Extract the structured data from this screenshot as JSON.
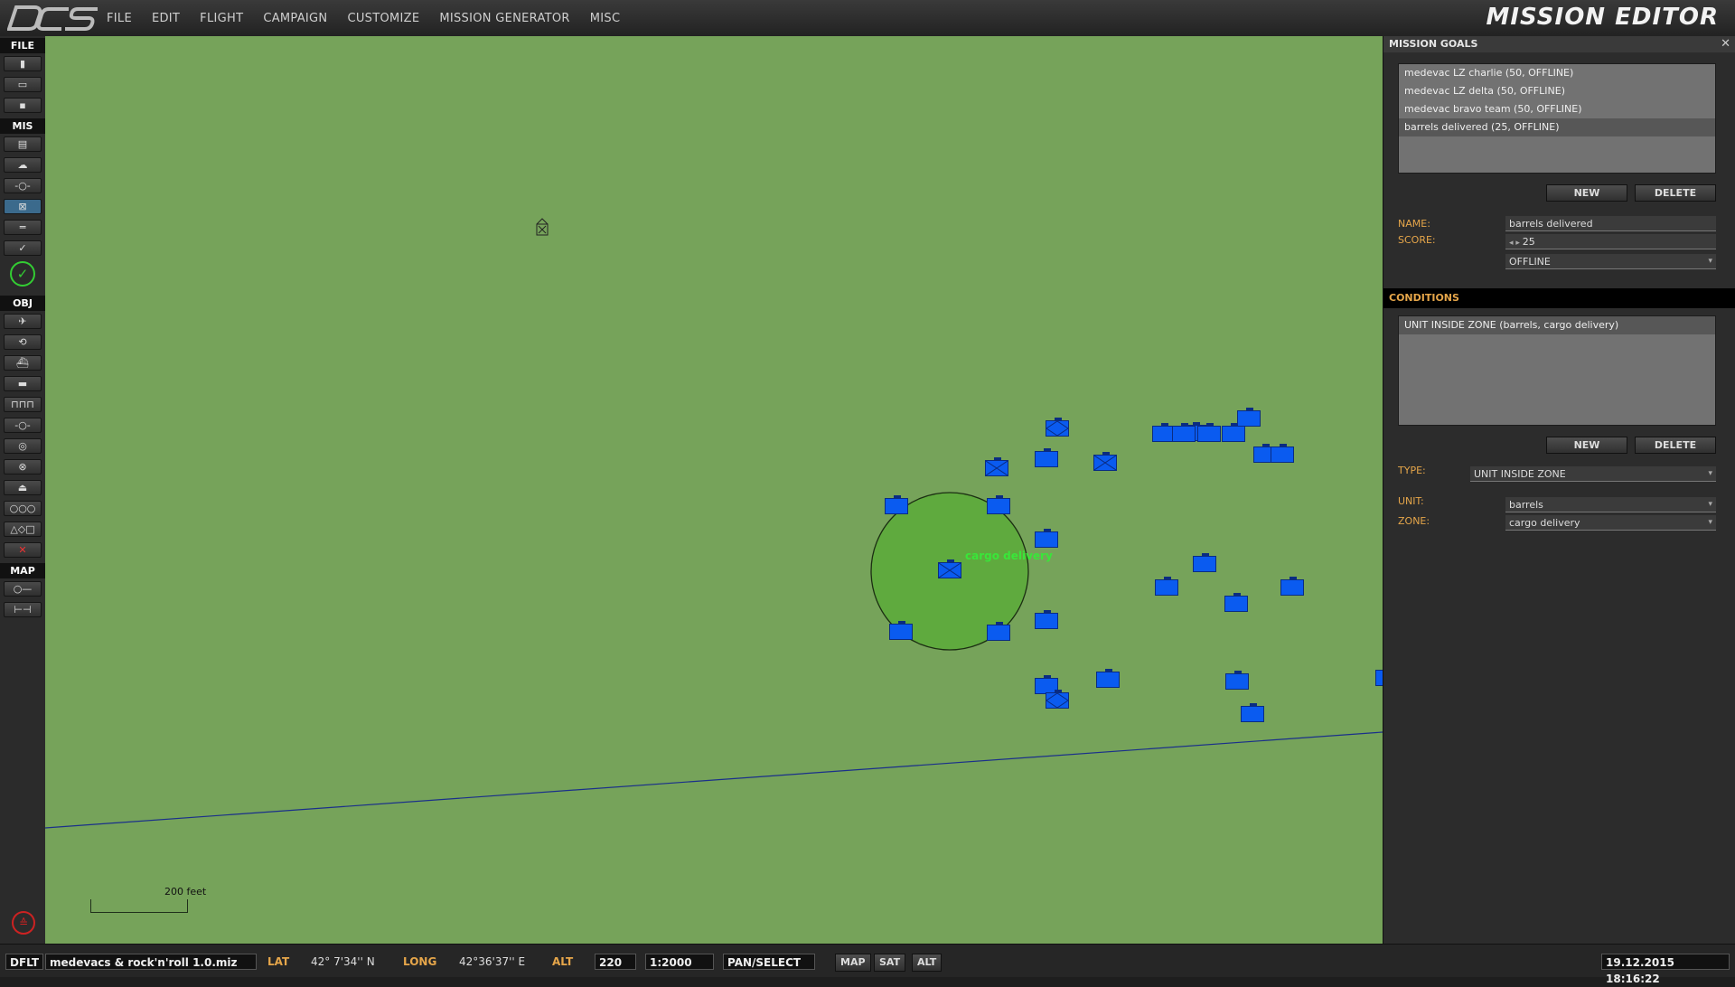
{
  "app": {
    "title": "MISSION EDITOR",
    "logo_text": "DCS"
  },
  "menu": [
    "FILE",
    "EDIT",
    "FLIGHT",
    "CAMPAIGN",
    "CUSTOMIZE",
    "MISSION GENERATOR",
    "MISC"
  ],
  "toolbar": {
    "sections": {
      "file": "FILE",
      "mis": "MIS",
      "obj": "OBJ",
      "map": "MAP"
    }
  },
  "map": {
    "zone_label": "cargo delivery",
    "scale_label": "200 feet"
  },
  "goals_panel": {
    "title": "MISSION GOALS",
    "goals": [
      "medevac LZ charlie (50, OFFLINE)",
      "medevac LZ delta (50, OFFLINE)",
      "medevac bravo team (50, OFFLINE)",
      "barrels delivered (25, OFFLINE)"
    ],
    "new_label": "NEW",
    "delete_label": "DELETE",
    "name_label": "NAME:",
    "name_value": "barrels delivered",
    "score_label": "SCORE:",
    "score_value": "25",
    "status_value": "OFFLINE"
  },
  "conditions_panel": {
    "title": "CONDITIONS",
    "conditions": [
      "UNIT INSIDE ZONE (barrels, cargo delivery)"
    ],
    "new_label": "NEW",
    "delete_label": "DELETE",
    "type_label": "TYPE:",
    "type_value": "UNIT INSIDE ZONE",
    "unit_label": "UNIT:",
    "unit_value": "barrels",
    "zone_label": "ZONE:",
    "zone_value": "cargo delivery"
  },
  "statusbar": {
    "mode": "DFLT",
    "filename": "medevacs & rock'n'roll 1.0.miz",
    "lat_label": "LAT",
    "lat_value": "42° 7'34'' N",
    "long_label": "LONG",
    "long_value": "42°36'37'' E",
    "alt_label": "ALT",
    "alt_value": "220",
    "scale": "1:2000",
    "tool": "PAN/SELECT",
    "btn_map": "MAP",
    "btn_sat": "SAT",
    "btn_alt": "ALT",
    "datetime": "19.12.2015 18:16:22"
  },
  "colors": {
    "map_bg": "#76a35a",
    "unit_blue": "#0a5bf0",
    "accent": "#e6a64a",
    "zone_label": "#39e639"
  }
}
